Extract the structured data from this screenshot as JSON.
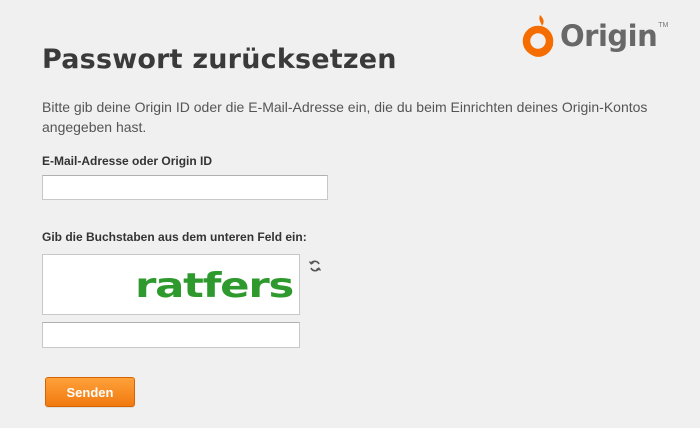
{
  "brand": {
    "name": "Origin",
    "trademark": "TM",
    "accent_color": "#f56c00"
  },
  "page": {
    "title": "Passwort zurücksetzen",
    "intro": "Bitte gib deine Origin ID oder die E-Mail-Adresse ein, die du beim Einrichten deines Origin-Kontos angegeben hast."
  },
  "form": {
    "email_label": "E-Mail-Adresse oder Origin ID",
    "email_value": "",
    "captcha_label": "Gib die Buchstaben aus dem unteren Feld ein:",
    "captcha_text": "ratfers",
    "captcha_color": "#2e9a2e",
    "captcha_value": "",
    "refresh_icon": "refresh-icon",
    "submit_label": "Senden",
    "submit_color": "#f58a1f"
  }
}
